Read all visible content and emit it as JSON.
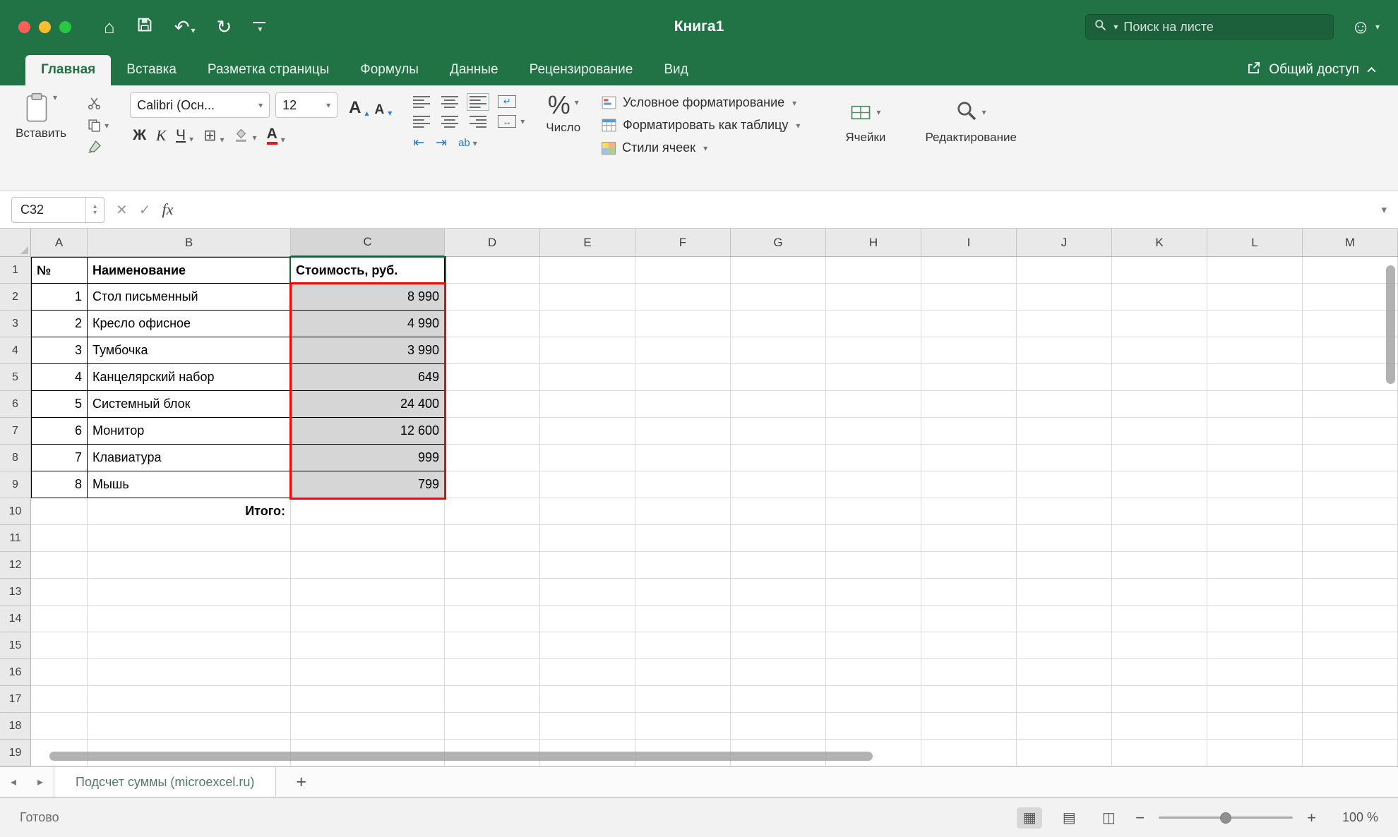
{
  "colors": {
    "excel_green": "#217346",
    "selection_red": "#ff0000",
    "range_fill": "#d6d6d6"
  },
  "window": {
    "title": "Книга1",
    "search_placeholder": "Поиск на листе"
  },
  "tabs": [
    "Главная",
    "Вставка",
    "Разметка страницы",
    "Формулы",
    "Данные",
    "Рецензирование",
    "Вид"
  ],
  "share_label": "Общий доступ",
  "ribbon": {
    "paste_label": "Вставить",
    "font_name": "Calibri (Осн...",
    "font_size": "12",
    "bold": "Ж",
    "italic": "К",
    "underline": "Ч",
    "font_color_letter": "A",
    "percent": "%",
    "number_label": "Число",
    "orientation_label": "ab",
    "conditional_formatting": "Условное форматирование",
    "format_as_table": "Форматировать как таблицу",
    "cell_styles": "Стили ячеек",
    "cells_label": "Ячейки",
    "editing_label": "Редактирование"
  },
  "formula_bar": {
    "name_box": "C32",
    "fx": "fx",
    "value": ""
  },
  "sheet": {
    "col_headers": [
      "A",
      "B",
      "C",
      "D",
      "E",
      "F",
      "G",
      "H",
      "I",
      "J",
      "K",
      "L",
      "M"
    ],
    "row_headers": [
      "1",
      "2",
      "3",
      "4",
      "5",
      "6",
      "7",
      "8",
      "9",
      "10",
      "11",
      "12",
      "13",
      "14",
      "15",
      "16",
      "17",
      "18",
      "19"
    ],
    "table": {
      "headers": {
        "A": "№",
        "B": "Наименование",
        "C": "Стоимость, руб."
      },
      "rows": [
        {
          "num": "1",
          "name": "Стол письменный",
          "value": "8 990"
        },
        {
          "num": "2",
          "name": "Кресло офисное",
          "value": "4 990"
        },
        {
          "num": "3",
          "name": "Тумбочка",
          "value": "3 990"
        },
        {
          "num": "4",
          "name": "Канцелярский набор",
          "value": "649"
        },
        {
          "num": "5",
          "name": "Системный блок",
          "value": "24 400"
        },
        {
          "num": "6",
          "name": "Монитор",
          "value": "12 600"
        },
        {
          "num": "7",
          "name": "Клавиатура",
          "value": "999"
        },
        {
          "num": "8",
          "name": "Мышь",
          "value": "799"
        }
      ],
      "total_label": "Итого:"
    }
  },
  "sheet_tabs": {
    "active": "Подсчет суммы (microexcel.ru)",
    "add_label": "+"
  },
  "status": {
    "ready": "Готово",
    "zoom": "100 %"
  }
}
